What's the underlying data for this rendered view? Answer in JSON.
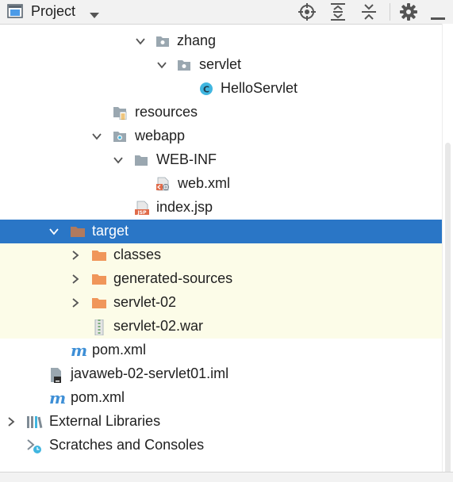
{
  "toolbar": {
    "title": "Project",
    "icons": [
      "project-view-icon",
      "dropdown-icon",
      "locate-icon",
      "expand-all-icon",
      "collapse-all-icon",
      "gear-icon",
      "hide-icon"
    ]
  },
  "tree": {
    "items": [
      {
        "label": "zhang",
        "icon": "package-icon",
        "expanded": true
      },
      {
        "label": "servlet",
        "icon": "package-icon",
        "expanded": true
      },
      {
        "label": "HelloServlet",
        "icon": "java-class-icon"
      },
      {
        "label": "resources",
        "icon": "resources-folder-icon"
      },
      {
        "label": "webapp",
        "icon": "web-folder-icon",
        "expanded": true
      },
      {
        "label": "WEB-INF",
        "icon": "folder-icon",
        "expanded": true
      },
      {
        "label": "web.xml",
        "icon": "web-xml-icon"
      },
      {
        "label": "index.jsp",
        "icon": "jsp-file-icon"
      },
      {
        "label": "target",
        "icon": "excluded-folder-icon",
        "expanded": true,
        "selected": true
      },
      {
        "label": "classes",
        "icon": "excluded-folder-icon",
        "expanded": false
      },
      {
        "label": "generated-sources",
        "icon": "excluded-folder-icon",
        "expanded": false
      },
      {
        "label": "servlet-02",
        "icon": "excluded-folder-icon",
        "expanded": false
      },
      {
        "label": "servlet-02.war",
        "icon": "archive-icon"
      },
      {
        "label": "pom.xml",
        "icon": "maven-icon"
      },
      {
        "label": "javaweb-02-servlet01.iml",
        "icon": "iml-file-icon"
      },
      {
        "label": "pom.xml",
        "icon": "maven-icon"
      },
      {
        "label": "External Libraries",
        "icon": "libraries-icon",
        "expanded": false
      },
      {
        "label": "Scratches and Consoles",
        "icon": "scratches-icon"
      }
    ]
  },
  "colors": {
    "selection": "#2a76c6",
    "excluded_background": "#fcfce8",
    "excluded_folder": "#f0965a",
    "folder": "#9aa7b0",
    "class_icon": "#40b6e0"
  }
}
